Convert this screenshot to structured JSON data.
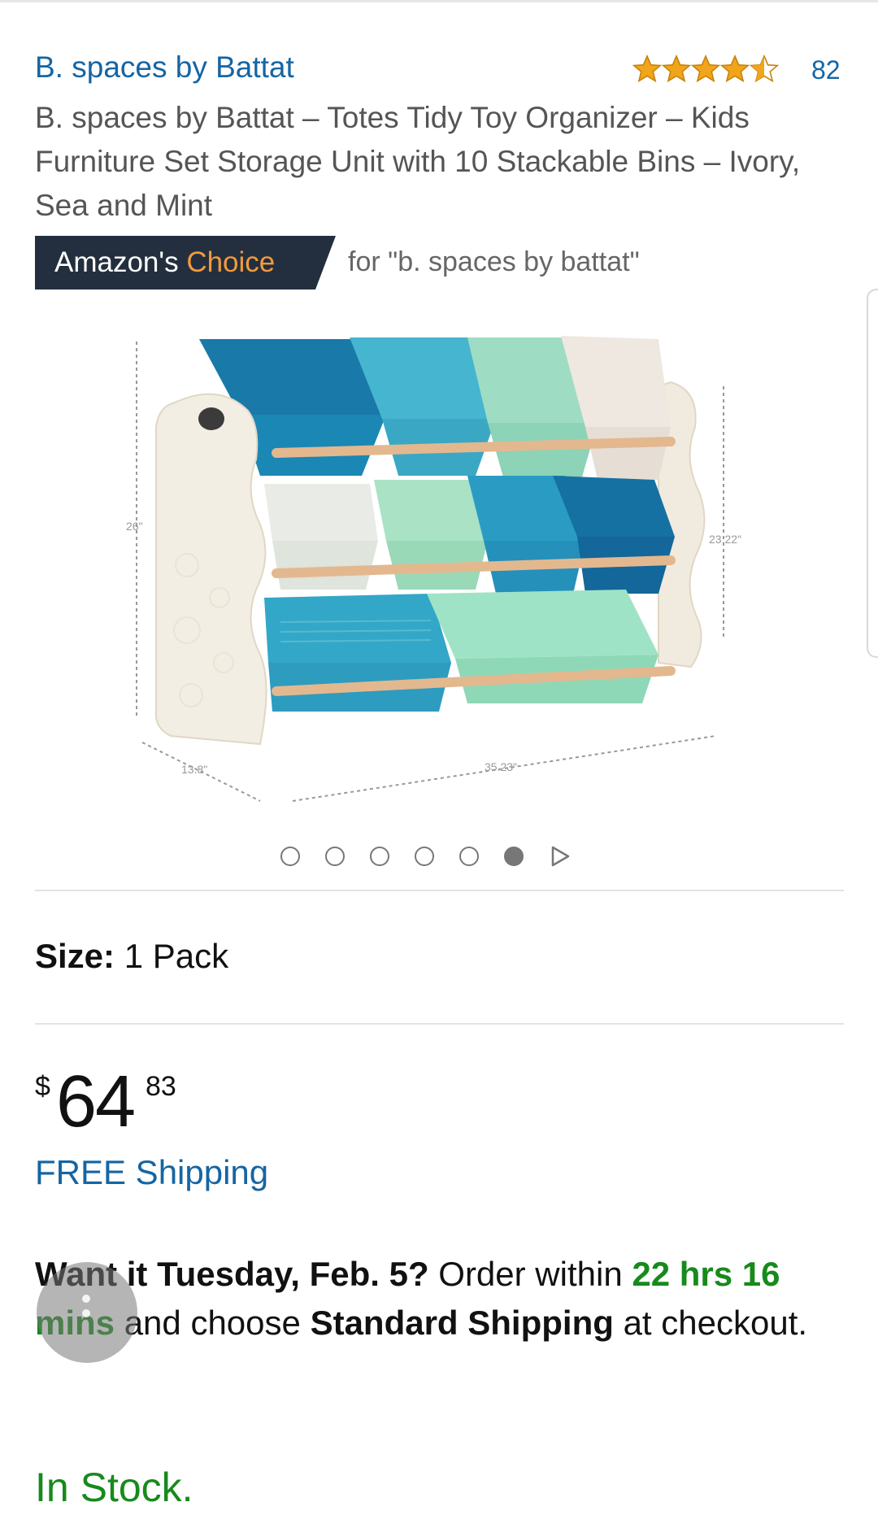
{
  "product": {
    "brand": "B. spaces by Battat",
    "rating_count": "82",
    "title": "B. spaces by Battat – Totes Tidy Toy Organizer – Kids Furniture Set Storage Unit with 10 Stackable Bins – Ivory, Sea and Mint",
    "rating": 4.5,
    "rating_max": 5
  },
  "badge": {
    "label_prefix": "Amazon's",
    "label_suffix": "Choice",
    "for_text": "for \"b. spaces by battat\""
  },
  "image": {
    "dimensions": [
      "26\"",
      "23.22\"",
      "13.8\"",
      "35.23\""
    ],
    "carousel_total": 6,
    "carousel_active": 6
  },
  "size": {
    "label": "Size:",
    "value": "1 Pack"
  },
  "price": {
    "currency": "$",
    "whole": "64",
    "fraction": "83"
  },
  "shipping": "FREE Shipping",
  "delivery": {
    "lead": "Want it Tuesday, Feb. 5?",
    "order_within": "Order within",
    "countdown": "22 hrs 16 mins",
    "and_choose": "and choose",
    "method": "Standard Shipping",
    "tail": "at checkout."
  },
  "stock": "In Stock.",
  "colors": {
    "link": "#1565a3",
    "badge_bg": "#232f3e",
    "badge_accent": "#f29a3c",
    "green": "#178a1c",
    "star": "#f0a51b"
  }
}
